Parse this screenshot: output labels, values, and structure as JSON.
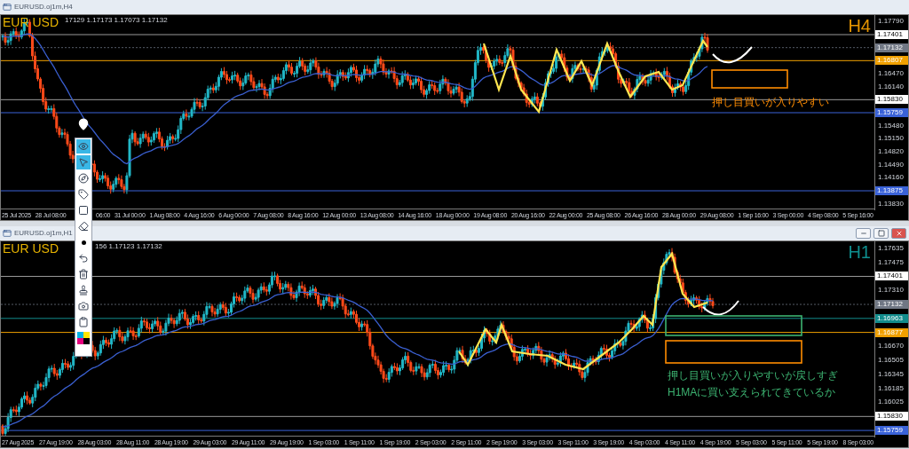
{
  "windows": [
    {
      "title": "EURUSD.oj1m,H4",
      "symbol": "EUR USD",
      "timeframe": {
        "text": "H4",
        "color": "#e69500"
      },
      "ohlc": "17129 1.17173 1.17073 1.17132",
      "price_axis": [
        {
          "kind": "tick",
          "text": "1.17790"
        },
        {
          "kind": "marker",
          "text": "1.17401",
          "color": "#ffffff"
        },
        {
          "kind": "marker",
          "text": "1.17132",
          "color": "#707784"
        },
        {
          "kind": "marker",
          "text": "1.16807",
          "color": "#f0a000"
        },
        {
          "kind": "tick",
          "text": "1.16470"
        },
        {
          "kind": "tick",
          "text": "1.16140"
        },
        {
          "kind": "marker",
          "text": "1.15830",
          "color": "#ffffff"
        },
        {
          "kind": "marker",
          "text": "1.15759",
          "color": "#3a62d8"
        },
        {
          "kind": "tick",
          "text": "1.15480"
        },
        {
          "kind": "tick",
          "text": "1.15150"
        },
        {
          "kind": "tick",
          "text": "1.14820"
        },
        {
          "kind": "tick",
          "text": "1.14490"
        },
        {
          "kind": "tick",
          "text": "1.14160"
        },
        {
          "kind": "marker",
          "text": "1.13875",
          "color": "#3a62d8"
        },
        {
          "kind": "tick",
          "text": "1.13830"
        }
      ],
      "time_axis": [
        "25 Jul 2025",
        "28 Jul 08:00",
        "06:00",
        "31 Jul 00:00",
        "1 Aug 08:00",
        "4 Aug 16:00",
        "6 Aug 00:00",
        "7 Aug 08:00",
        "8 Aug 16:00",
        "12 Aug 00:00",
        "13 Aug 08:00",
        "14 Aug 16:00",
        "18 Aug 00:00",
        "19 Aug 08:00",
        "20 Aug 16:00",
        "22 Aug 00:00",
        "25 Aug 08:00",
        "26 Aug 16:00",
        "28 Aug 00:00",
        "29 Aug 08:00",
        "1 Sep 16:00",
        "3 Sep 00:00",
        "4 Sep 08:00",
        "5 Sep 16:00"
      ],
      "notes": [
        {
          "text": "押し目買いが入りやすい",
          "color": "#ff8c00"
        }
      ]
    },
    {
      "title": "EURUSD.oj1m,H1",
      "buttons": [
        {
          "kind": "minimize"
        },
        {
          "kind": "maximize"
        },
        {
          "kind": "close"
        }
      ],
      "symbol": "EUR USD",
      "timeframe": {
        "text": "H1",
        "color": "#0e8f8f"
      },
      "ohlc": "156 1.17123 1.17132",
      "price_axis": [
        {
          "kind": "tick",
          "text": "1.17635"
        },
        {
          "kind": "tick",
          "text": "1.17475"
        },
        {
          "kind": "marker",
          "text": "1.17401",
          "color": "#ffffff"
        },
        {
          "kind": "tick",
          "text": "1.17310"
        },
        {
          "kind": "marker",
          "text": "1.17132",
          "color": "#707784"
        },
        {
          "kind": "marker",
          "text": "1.16963",
          "color": "#128c8c"
        },
        {
          "kind": "marker",
          "text": "1.16877",
          "color": "#f0a000"
        },
        {
          "kind": "tick",
          "text": "1.16670"
        },
        {
          "kind": "tick",
          "text": "1.16505"
        },
        {
          "kind": "tick",
          "text": "1.16345"
        },
        {
          "kind": "tick",
          "text": "1.16185"
        },
        {
          "kind": "tick",
          "text": "1.16025"
        },
        {
          "kind": "marker",
          "text": "1.15830",
          "color": "#ffffff"
        },
        {
          "kind": "marker",
          "text": "1.15759",
          "color": "#3a62d8"
        }
      ],
      "time_axis": [
        "27 Aug 2025",
        "27 Aug 19:00",
        "28 Aug 03:00",
        "28 Aug 11:00",
        "28 Aug 19:00",
        "29 Aug 03:00",
        "29 Aug 11:00",
        "29 Aug 19:00",
        "1 Sep 03:00",
        "1 Sep 11:00",
        "1 Sep 19:00",
        "2 Sep 03:00",
        "2 Sep 11:00",
        "2 Sep 19:00",
        "3 Sep 03:00",
        "3 Sep 11:00",
        "3 Sep 19:00",
        "4 Sep 03:00",
        "4 Sep 11:00",
        "4 Sep 19:00",
        "5 Sep 03:00",
        "5 Sep 11:00",
        "5 Sep 19:00",
        "8 Sep 03:00"
      ],
      "notes": [
        {
          "text": "押し目買いが入りやすいが戻しすぎ",
          "color": "#3cb371"
        },
        {
          "text": "H1MAに買い支えられてきているか",
          "color": "#3cb371"
        }
      ]
    }
  ],
  "toolbar": {
    "tools": [
      {
        "kind": "pin",
        "selected": false
      },
      {
        "kind": "eye",
        "selected": true
      },
      {
        "kind": "cursor",
        "selected": true
      },
      {
        "kind": "compass",
        "selected": false
      },
      {
        "kind": "tag",
        "selected": false
      },
      {
        "kind": "square",
        "selected": false
      },
      {
        "kind": "eraser",
        "selected": false
      },
      {
        "kind": "dot",
        "selected": false
      },
      {
        "kind": "undo",
        "selected": false
      },
      {
        "kind": "trash",
        "selected": false
      },
      {
        "kind": "stamp",
        "selected": false
      },
      {
        "kind": "camera",
        "selected": false
      },
      {
        "kind": "clipboard",
        "selected": false
      },
      {
        "kind": "palette",
        "selected": false
      }
    ]
  }
}
